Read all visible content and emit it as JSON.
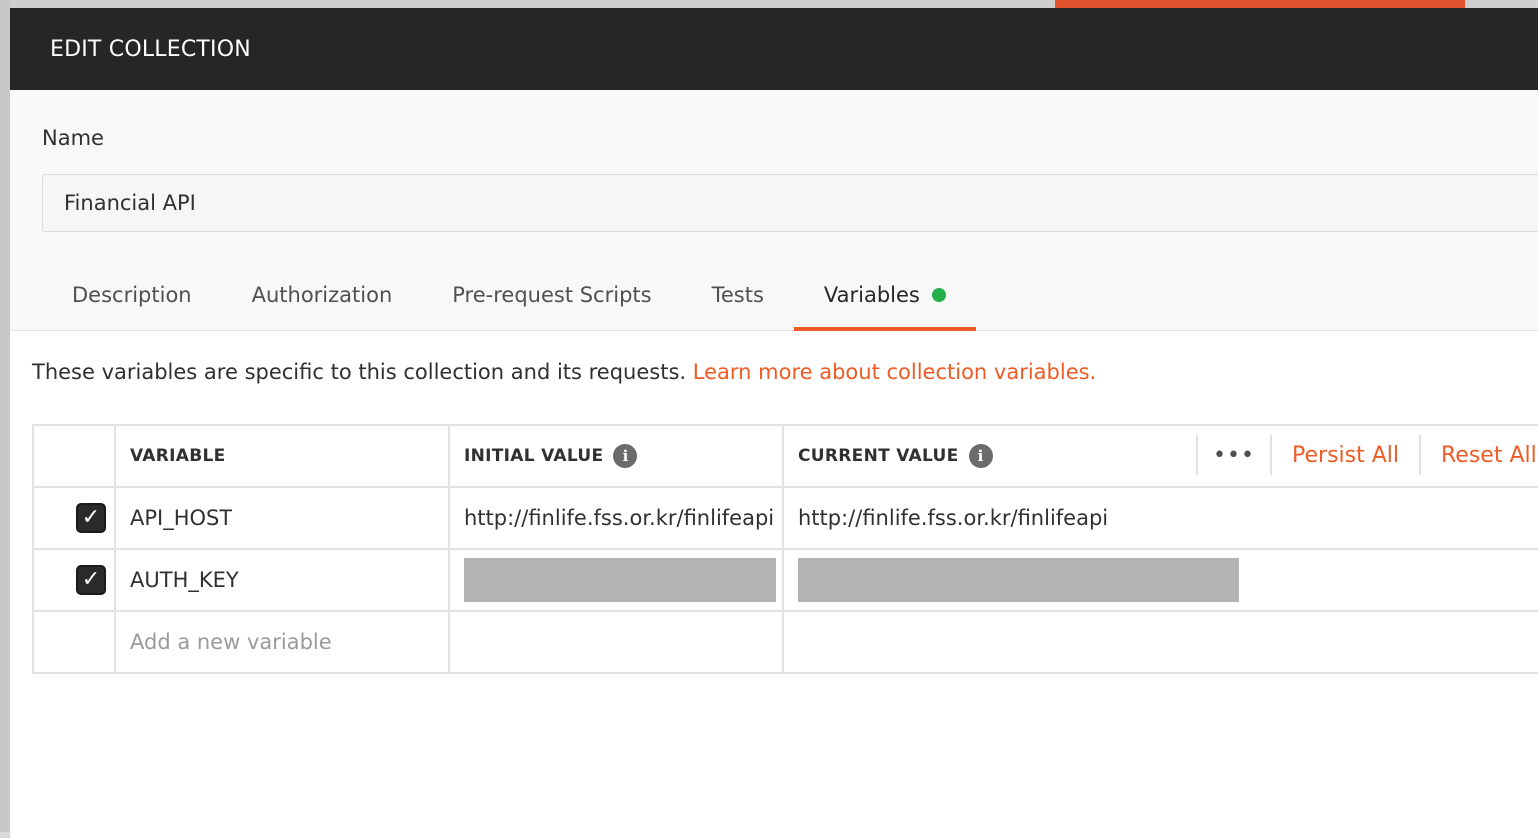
{
  "modal": {
    "title": "EDIT COLLECTION"
  },
  "name_field": {
    "label": "Name",
    "value": "Financial API"
  },
  "tabs": [
    {
      "label": "Description",
      "active": false
    },
    {
      "label": "Authorization",
      "active": false
    },
    {
      "label": "Pre-request Scripts",
      "active": false
    },
    {
      "label": "Tests",
      "active": false
    },
    {
      "label": "Variables",
      "active": true,
      "has_indicator": true
    }
  ],
  "variables_panel": {
    "description": "These variables are specific to this collection and its requests.",
    "learn_more_link": "Learn more about collection variables.",
    "columns": {
      "variable": "VARIABLE",
      "initial_value": "INITIAL VALUE",
      "current_value": "CURRENT VALUE"
    },
    "header_actions": {
      "more": "•••",
      "persist_all": "Persist All",
      "reset_all": "Reset All"
    },
    "rows": [
      {
        "enabled": true,
        "key": "API_HOST",
        "initial_value": "http://finlife.fss.or.kr/finlifeapi",
        "current_value": "http://finlife.fss.or.kr/finlifeapi",
        "redacted": false
      },
      {
        "enabled": true,
        "key": "AUTH_KEY",
        "initial_value": "",
        "current_value": "",
        "redacted": true
      }
    ],
    "new_row_placeholder": "Add a new variable"
  },
  "colors": {
    "accent": "#ef5b25",
    "header_bg": "#262626",
    "indicator": "#26b04a"
  }
}
